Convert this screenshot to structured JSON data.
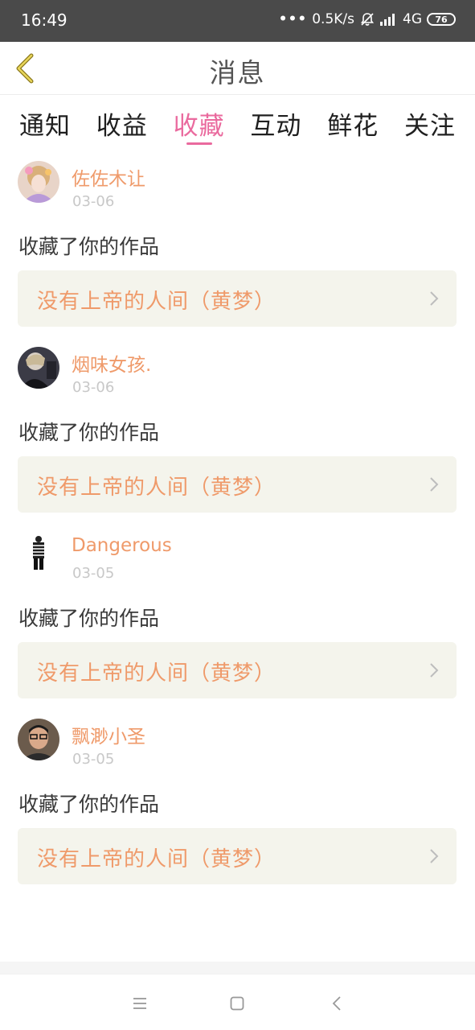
{
  "status_bar": {
    "time": "16:49",
    "network_speed": "0.5K/s",
    "network_type": "4G",
    "battery": "76"
  },
  "header": {
    "title": "消息"
  },
  "tabs": [
    {
      "label": "通知",
      "active": false
    },
    {
      "label": "收益",
      "active": false
    },
    {
      "label": "收藏",
      "active": true
    },
    {
      "label": "互动",
      "active": false
    },
    {
      "label": "鲜花",
      "active": false
    },
    {
      "label": "关注",
      "active": false
    }
  ],
  "messages": [
    {
      "username": "佐佐木让",
      "date": "03-06",
      "action": "收藏了你的作品",
      "work_title": "没有上帝的人间（黄梦）"
    },
    {
      "username": "烟味女孩.",
      "date": "03-06",
      "action": "收藏了你的作品",
      "work_title": "没有上帝的人间（黄梦）"
    },
    {
      "username": "Dangerous",
      "date": "03-05",
      "action": "收藏了你的作品",
      "work_title": "没有上帝的人间（黄梦）"
    },
    {
      "username": "飘渺小圣",
      "date": "03-05",
      "action": "收藏了你的作品",
      "work_title": "没有上帝的人间（黄梦）"
    }
  ],
  "colors": {
    "accent_pink": "#ea6a9e",
    "username_orange": "#ef9a6a",
    "status_bar_bg": "#4a4a4a"
  }
}
